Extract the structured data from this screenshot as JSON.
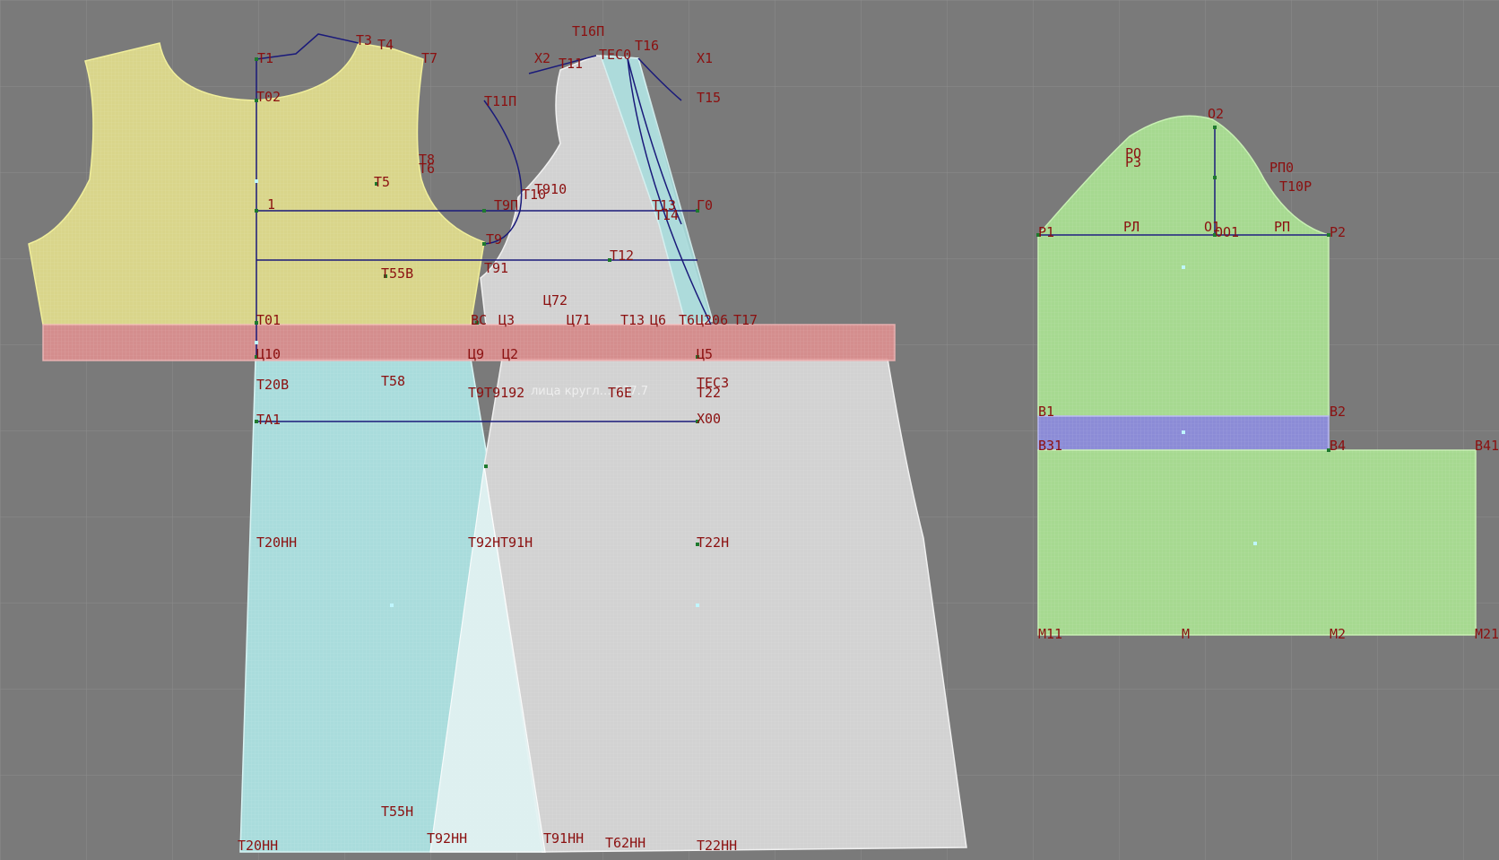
{
  "colors": {
    "background": "#7a7a7a",
    "grid": "#8a8a8a",
    "bodice_back": "#d9d58a",
    "waistband": "#dc8f8f",
    "skirt_cyan": "#a9dcdc",
    "front_white": "#d2d2d2",
    "sleeve_green": "#a6d990",
    "cuff_blue": "#8b8bd6",
    "construction_line": "#1a1a7a",
    "point_label": "#8b1010",
    "point_marker": "#1e7a2e"
  },
  "overlay_text": "лица кругл… 237.7",
  "labels": {
    "T1": "T1",
    "T3": "T3",
    "T4": "T4",
    "T7": "T7",
    "T02": "T02",
    "T5": "T5",
    "T8": "T8",
    "T6": "T6",
    "N1": "1",
    "T55B": "T55B",
    "T01": "T01",
    "C10": "Ц10",
    "T20B": "T20B",
    "T58": "T58",
    "TA1": "TA1",
    "T20HH_mid": "T20HH",
    "T55H": "T55H",
    "T20HH": "T20HH",
    "T16P": "T16П",
    "X2": "X2",
    "T11": "T11",
    "TEC0": "TEC0",
    "T16": "T16",
    "X1": "X1",
    "T15": "T15",
    "T11P": "T11П",
    "T910": "T910",
    "T10": "T10",
    "T9P": "T9П",
    "T13": "T13",
    "T14": "T14",
    "G0": "Г0",
    "T9": "T9",
    "T12": "T12",
    "T91": "T91",
    "C72": "Ц72",
    "BC": "BC",
    "C3": "Ц3",
    "C71": "Ц71",
    "T13b": "T13",
    "C6": "Ц6",
    "T6b": "T6",
    "C206": "Ц206",
    "T17": "T17",
    "C9": "Ц9",
    "C2": "Ц2",
    "C5": "Ц5",
    "T9192": "T9T9192",
    "T6E": "T6E",
    "TEC3": "TEC3",
    "T22": "T22",
    "X00": "X00",
    "T92H": "T92H",
    "T91H": "T91H",
    "T22H": "T22H",
    "T92HH": "T92HH",
    "T91HH": "T91HH",
    "T62HH": "T62HH",
    "T22HH": "T22HH",
    "O2": "O2",
    "PO": "PO",
    "P3": "P3",
    "RP0": "PП0",
    "T10P": "T10P",
    "P1": "P1",
    "PL": "PЛ",
    "O1": "O1",
    "O01": "OO1",
    "PP": "PП",
    "P2": "P2",
    "B1": "B1",
    "B2": "B2",
    "B31": "B31",
    "B4": "B4",
    "B41": "B41",
    "M11": "M11",
    "M": "M",
    "M2": "M2",
    "M21": "M21"
  }
}
